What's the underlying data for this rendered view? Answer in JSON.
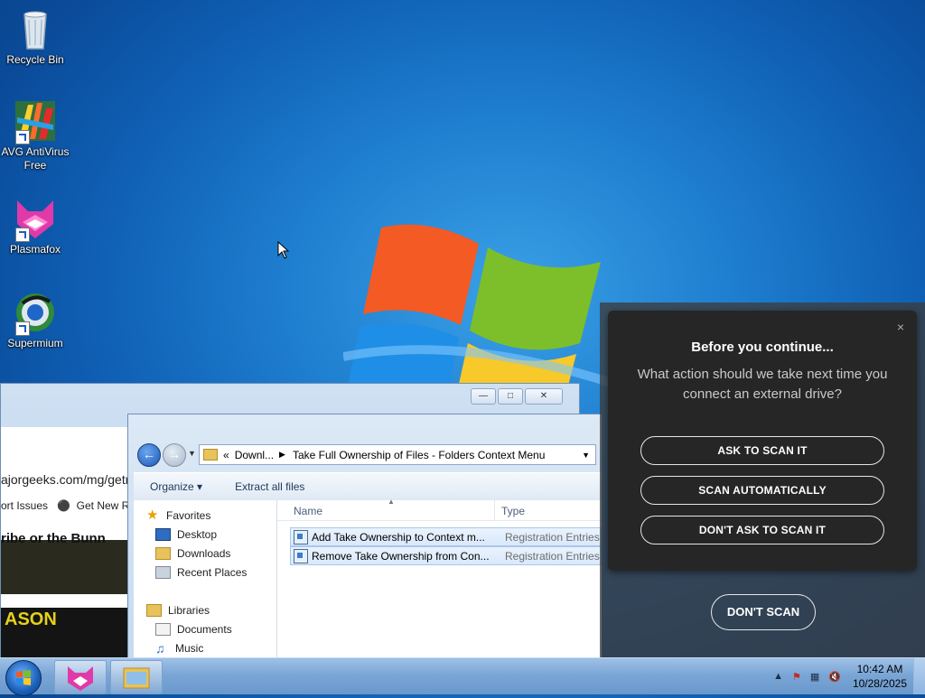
{
  "desktop": {
    "icons": [
      {
        "label": "Recycle Bin",
        "icon": "recycle-bin-icon"
      },
      {
        "label": "AVG AntiVirus Free",
        "icon": "avg-antivirus-icon"
      },
      {
        "label": "Plasmafox",
        "icon": "plasmafox-icon"
      },
      {
        "label": "Supermium",
        "icon": "supermium-icon"
      }
    ]
  },
  "browser": {
    "url": "ajorgeeks.com/mg/getr",
    "bookmarks": [
      "ort Issues",
      "Get New Rel"
    ],
    "page_text": "ribe or the Bunn",
    "banner_text": "ASON"
  },
  "explorer": {
    "breadcrumb": {
      "prefix": "«",
      "parent": "Downl...",
      "current": "Take Full Ownership of Files - Folders Context Menu"
    },
    "toolbar": {
      "organize": "Organize",
      "extract": "Extract all files"
    },
    "nav": {
      "favorites": "Favorites",
      "desktop": "Desktop",
      "downloads": "Downloads",
      "recent": "Recent Places",
      "libraries": "Libraries",
      "documents": "Documents",
      "music": "Music"
    },
    "columns": {
      "name": "Name",
      "type": "Type"
    },
    "files": [
      {
        "name": "Add Take Ownership to Context m...",
        "type": "Registration Entries"
      },
      {
        "name": "Remove Take Ownership from Con...",
        "type": "Registration Entries"
      }
    ]
  },
  "av_popup": {
    "title": "Before you continue...",
    "message": "What action should we take next time you connect an external drive?",
    "buttons": {
      "ask": "ASK TO SCAN IT",
      "auto": "SCAN AUTOMATICALLY",
      "dont_ask": "DON'T ASK TO SCAN IT"
    },
    "dont_scan": "DON'T SCAN",
    "close": "×"
  },
  "taskbar": {
    "time": "10:42 AM",
    "date": "10/28/2025"
  },
  "colors": {
    "desktop_bg": "#1f7fd0",
    "popup_bg": "#262626",
    "taskbar": "#7aa6d6"
  }
}
